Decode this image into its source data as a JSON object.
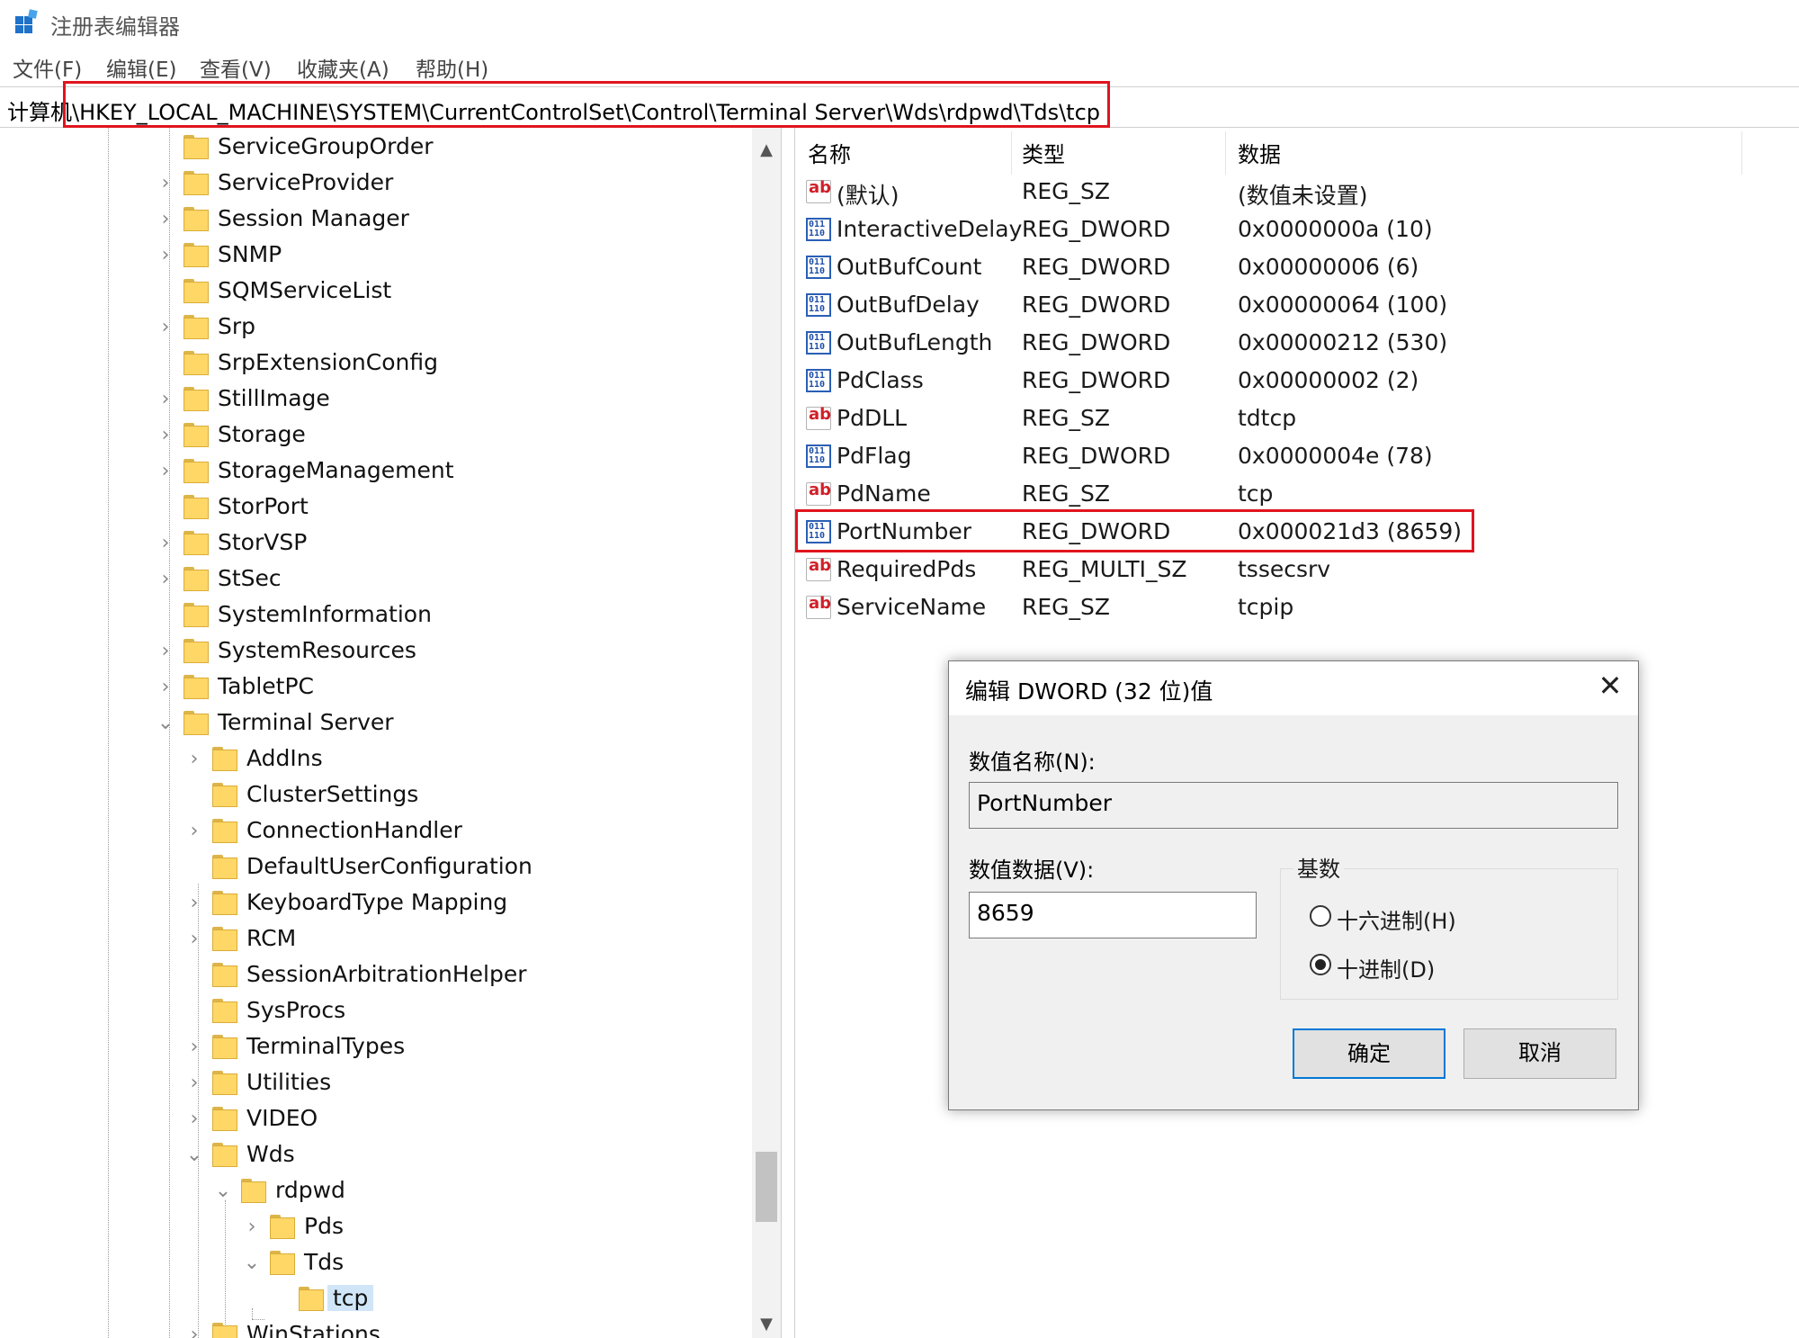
{
  "window": {
    "title": "注册表编辑器"
  },
  "menu": [
    "文件(F)",
    "编辑(E)",
    "查看(V)",
    "收藏夹(A)",
    "帮助(H)"
  ],
  "address": {
    "path": "计算机\\HKEY_LOCAL_MACHINE\\SYSTEM\\CurrentControlSet\\Control\\Terminal Server\\Wds\\rdpwd\\Tds\\tcp"
  },
  "tree": {
    "items": [
      "ServiceGroupOrder",
      "ServiceProvider",
      "Session Manager",
      "SNMP",
      "SQMServiceList",
      "Srp",
      "SrpExtensionConfig",
      "StillImage",
      "Storage",
      "StorageManagement",
      "StorPort",
      "StorVSP",
      "StSec",
      "SystemInformation",
      "SystemResources",
      "TabletPC",
      "Terminal Server",
      "AddIns",
      "ClusterSettings",
      "ConnectionHandler",
      "DefaultUserConfiguration",
      "KeyboardType Mapping",
      "RCM",
      "SessionArbitrationHelper",
      "SysProcs",
      "TerminalTypes",
      "Utilities",
      "VIDEO",
      "Wds",
      "rdpwd",
      "Pds",
      "Tds",
      "tcp",
      "WinStations"
    ]
  },
  "list": {
    "headers": {
      "name": "名称",
      "type": "类型",
      "data": "数据"
    },
    "rows": [
      {
        "icon": "string-value-icon",
        "name": "(默认)",
        "type": "REG_SZ",
        "data": "(数值未设置)"
      },
      {
        "icon": "binary-value-icon",
        "name": "InteractiveDelay",
        "type": "REG_DWORD",
        "data": "0x0000000a (10)"
      },
      {
        "icon": "binary-value-icon",
        "name": "OutBufCount",
        "type": "REG_DWORD",
        "data": "0x00000006 (6)"
      },
      {
        "icon": "binary-value-icon",
        "name": "OutBufDelay",
        "type": "REG_DWORD",
        "data": "0x00000064 (100)"
      },
      {
        "icon": "binary-value-icon",
        "name": "OutBufLength",
        "type": "REG_DWORD",
        "data": "0x00000212 (530)"
      },
      {
        "icon": "binary-value-icon",
        "name": "PdClass",
        "type": "REG_DWORD",
        "data": "0x00000002 (2)"
      },
      {
        "icon": "string-value-icon",
        "name": "PdDLL",
        "type": "REG_SZ",
        "data": "tdtcp"
      },
      {
        "icon": "binary-value-icon",
        "name": "PdFlag",
        "type": "REG_DWORD",
        "data": "0x0000004e (78)"
      },
      {
        "icon": "string-value-icon",
        "name": "PdName",
        "type": "REG_SZ",
        "data": "tcp"
      },
      {
        "icon": "binary-value-icon",
        "name": "PortNumber",
        "type": "REG_DWORD",
        "data": "0x000021d3 (8659)"
      },
      {
        "icon": "string-value-icon",
        "name": "RequiredPds",
        "type": "REG_MULTI_SZ",
        "data": "tssecsrv"
      },
      {
        "icon": "string-value-icon",
        "name": "ServiceName",
        "type": "REG_SZ",
        "data": "tcpip"
      }
    ]
  },
  "dialog": {
    "title": "编辑 DWORD (32 位)值",
    "name_label": "数值名称(N):",
    "name_value": "PortNumber",
    "data_label": "数值数据(V):",
    "data_value": "8659",
    "base_label": "基数",
    "hex_label": "十六进制(H)",
    "dec_label": "十进制(D)",
    "selected_base": "dec",
    "ok_label": "确定",
    "cancel_label": "取消"
  },
  "colors": {
    "highlight_border": "#e0141e",
    "selection": "#d0e6f8",
    "accent": "#0078d7",
    "folder": "#ffd766"
  }
}
